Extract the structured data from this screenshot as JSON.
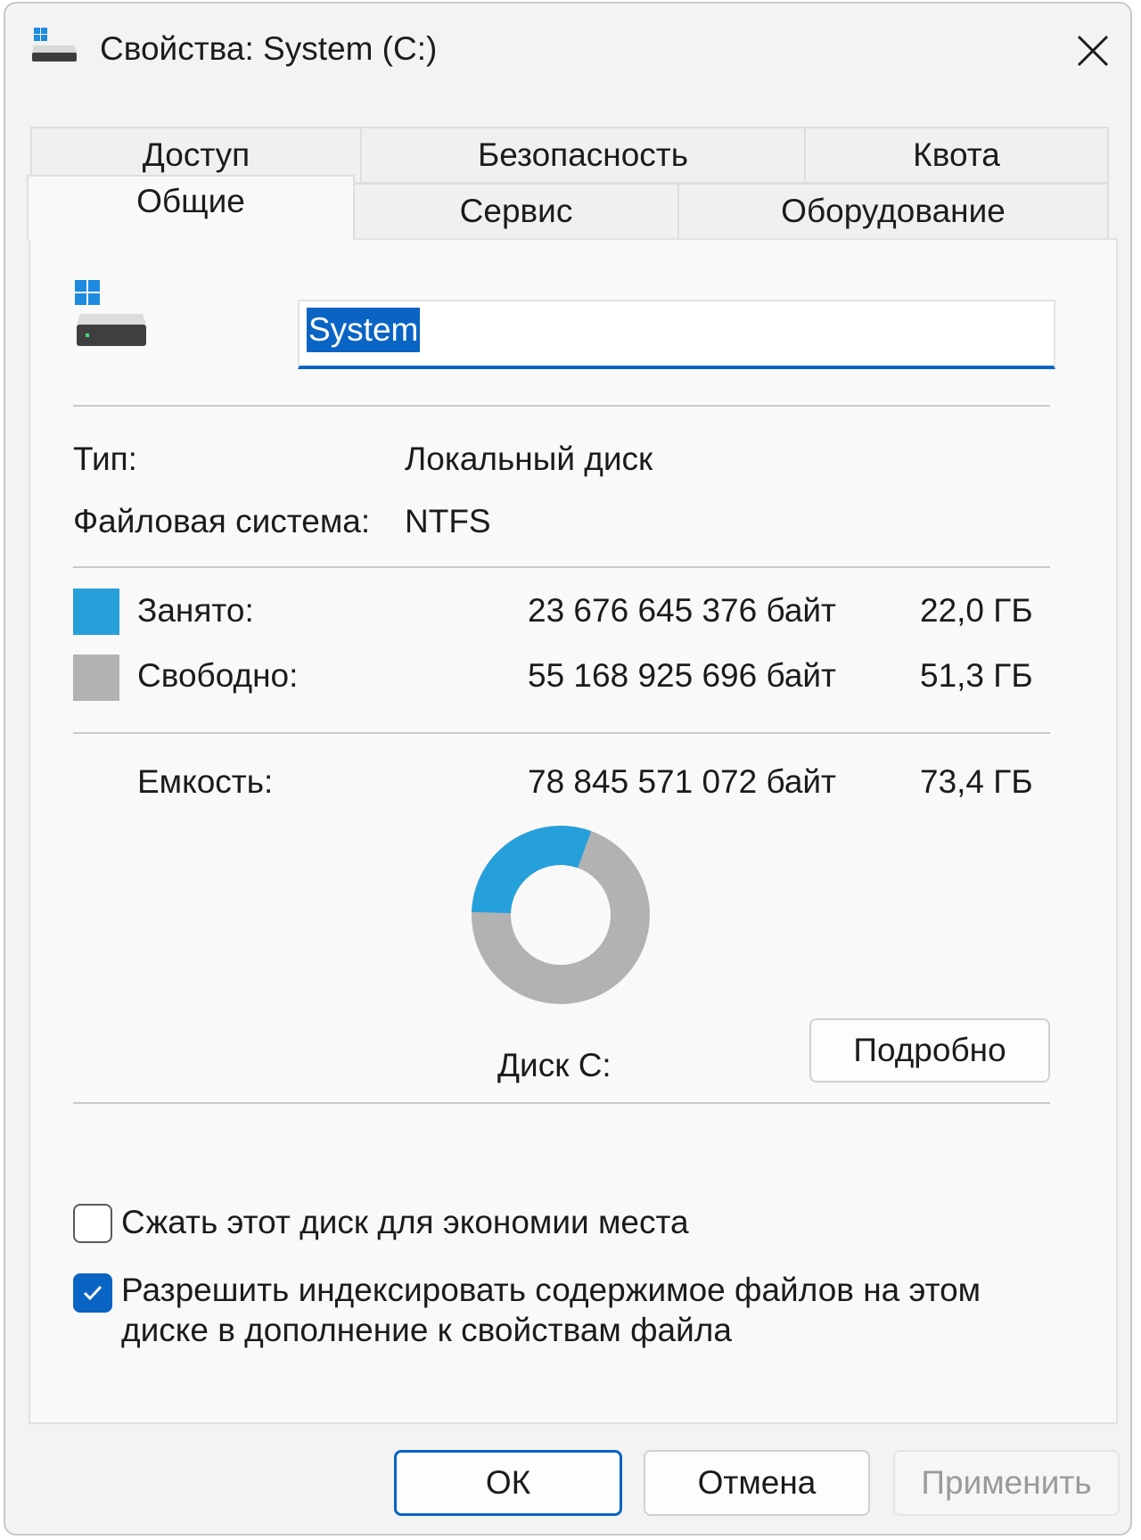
{
  "window": {
    "title": "Свойства: System (C:)"
  },
  "tabs": {
    "row1": [
      "Доступ",
      "Безопасность",
      "Квота"
    ],
    "row2": [
      "Общие",
      "Сервис",
      "Оборудование"
    ],
    "active": "Общие"
  },
  "general": {
    "name_value": "System",
    "type_label": "Тип:",
    "type_value": "Локальный диск",
    "fs_label": "Файловая система:",
    "fs_value": "NTFS",
    "used_label": "Занято:",
    "used_bytes": "23 676 645 376 байт",
    "used_gb": "22,0 ГБ",
    "free_label": "Свободно:",
    "free_bytes": "55 168 925 696 байт",
    "free_gb": "51,3 ГБ",
    "capacity_label": "Емкость:",
    "capacity_bytes": "78 845 571 072 байт",
    "capacity_gb": "73,4 ГБ",
    "disk_label": "Диск C:",
    "details_button": "Подробно",
    "used_fraction": 0.3003,
    "colors": {
      "used": "#26a0da",
      "free": "#b2b2b2"
    }
  },
  "options": {
    "compress_label": "Сжать этот диск для экономии места",
    "compress_checked": false,
    "index_label_line1": "Разрешить индексировать содержимое файлов на этом",
    "index_label_line2": "диске в дополнение к свойствам файла",
    "index_checked": true
  },
  "footer": {
    "ok": "ОК",
    "cancel": "Отмена",
    "apply": "Применить"
  },
  "icons": [
    "drive-icon",
    "close-icon",
    "checkmark-icon"
  ]
}
